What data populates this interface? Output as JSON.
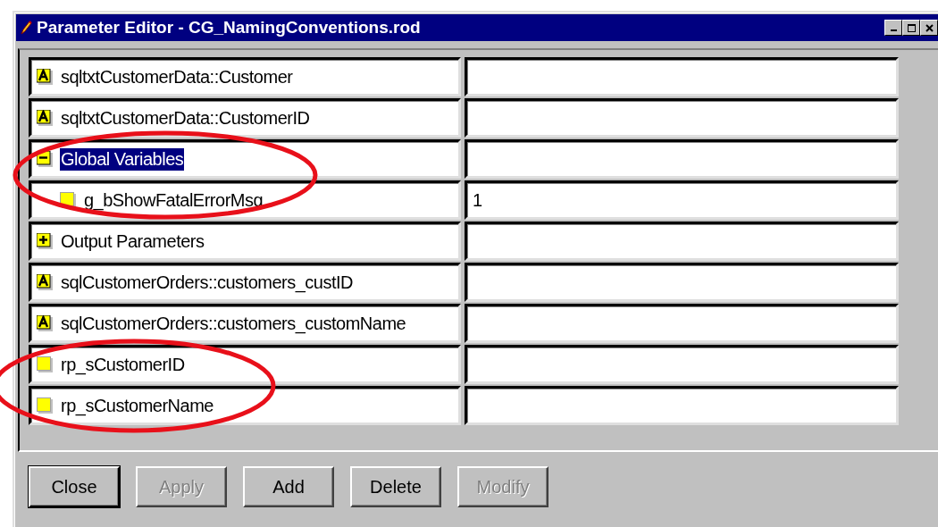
{
  "window": {
    "title": "Parameter Editor - CG_NamingConventions.rod"
  },
  "parameters": [
    {
      "kind": "field",
      "name": "sqltxtCustomerData::Customer",
      "selected": false
    },
    {
      "kind": "field",
      "name": "sqltxtCustomerData::CustomerID",
      "selected": false
    },
    {
      "kind": "group",
      "name": "Global Variables",
      "selected": true,
      "expanded": true,
      "children": [
        {
          "kind": "variable",
          "name": "g_bShowFatalErrorMsg",
          "selected": false,
          "value": "1"
        }
      ]
    },
    {
      "kind": "group",
      "name": "Output Parameters",
      "selected": false,
      "expanded": false
    },
    {
      "kind": "field",
      "name": "sqlCustomerOrders::customers_custID",
      "selected": false
    },
    {
      "kind": "field",
      "name": "sqlCustomerOrders::customers_customName",
      "selected": false
    },
    {
      "kind": "variable",
      "name": "rp_sCustomerID",
      "selected": false
    },
    {
      "kind": "variable",
      "name": "rp_sCustomerName",
      "selected": false
    }
  ],
  "buttons": [
    {
      "label": "Close",
      "disabled": false,
      "default": true
    },
    {
      "label": "Apply",
      "disabled": true,
      "default": false
    },
    {
      "label": "Add",
      "disabled": false,
      "default": false
    },
    {
      "label": "Delete",
      "disabled": false,
      "default": false
    },
    {
      "label": "Modify",
      "disabled": true,
      "default": false
    }
  ]
}
